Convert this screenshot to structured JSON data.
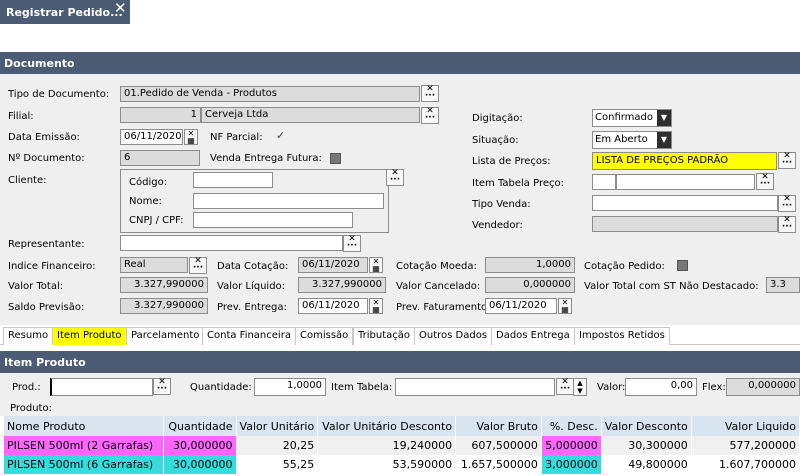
{
  "window": {
    "tab_title": "Registrar Pedido...",
    "close_glyph": "✕"
  },
  "colors": {
    "header": "#4b5b73",
    "highlight_yellow": "#ffff00",
    "magenta": "#ff66ff",
    "cyan": "#33dddd"
  },
  "documento": {
    "title": "Documento",
    "tipo_documento": {
      "label": "Tipo de Documento:",
      "value": "01.Pedido de Venda - Produtos"
    },
    "filial": {
      "label": "Filial:",
      "code": "1",
      "name": "Cerveja Ltda"
    },
    "data_emissao": {
      "label": "Data Emissão:",
      "value": "06/11/2020"
    },
    "nf_parcial": {
      "label": "NF Parcial:",
      "checked": "✓"
    },
    "n_documento": {
      "label": "Nº Documento:",
      "value": "6"
    },
    "venda_entrega_futura": {
      "label": "Venda Entrega Futura:"
    },
    "cliente": {
      "label": "Cliente:",
      "codigo_label": "Código:",
      "nome_label": "Nome:",
      "cnpj_label": "CNPJ / CPF:"
    },
    "digitacao": {
      "label": "Digitação:",
      "value": "Confirmado"
    },
    "situacao": {
      "label": "Situação:",
      "value": "Em Aberto"
    },
    "lista_precos": {
      "label": "Lista de Preços:",
      "value": "LISTA DE PREÇOS PADRÃO"
    },
    "item_tabela_preco": {
      "label": "Item Tabela Preço:"
    },
    "tipo_venda": {
      "label": "Tipo Venda:"
    },
    "vendedor": {
      "label": "Vendedor:"
    },
    "representante": {
      "label": "Representante:"
    },
    "indice_financeiro": {
      "label": "Indice Financeiro:",
      "value": "Real"
    },
    "data_cotacao": {
      "label": "Data Cotação:",
      "value": "06/11/2020"
    },
    "cotacao_moeda": {
      "label": "Cotação Moeda:",
      "value": "1,0000"
    },
    "cotacao_pedido": {
      "label": "Cotação Pedido:"
    },
    "valor_total": {
      "label": "Valor Total:",
      "value": "3.327,990000"
    },
    "valor_liquido": {
      "label": "Valor Líquido:",
      "value": "3.327,990000"
    },
    "valor_cancelado": {
      "label": "Valor Cancelado:",
      "value": "0,000000"
    },
    "valor_total_st": {
      "label": "Valor Total com ST Não Destacado:",
      "value": "3.3"
    },
    "saldo_previsao": {
      "label": "Saldo Previsão:",
      "value": "3.327,990000"
    },
    "prev_entrega": {
      "label": "Prev. Entrega:",
      "value": "06/11/2020"
    },
    "prev_faturamento": {
      "label": "Prev. Faturamento:",
      "value": "06/11/2020"
    }
  },
  "subtabs": [
    "Resumo",
    "Item Produto",
    "Parcelamento",
    "Conta Financeira",
    "Comissão",
    "Tributação",
    "Outros Dados",
    "Dados Entrega",
    "Impostos Retidos"
  ],
  "item_produto": {
    "title": "Item Produto",
    "prod_label": "Prod.:",
    "quantidade_label": "Quantidade:",
    "quantidade_value": "1,0000",
    "item_tabela_label": "Item Tabela:",
    "valor_label": "Valor:",
    "valor_value": "0,00",
    "flex_label": "Flex:",
    "flex_value": "0,000000",
    "produto_label": "Produto:"
  },
  "table": {
    "columns": [
      "Nome Produto",
      "Quantidade",
      "Valor Unitário",
      "Valor Unitário Desconto",
      "Valor Bruto",
      "%. Desc.",
      "Valor Desconto",
      "Valor Liquido"
    ],
    "rows": [
      [
        "PILSEN 500ml (2 Garrafas)",
        "30,000000",
        "20,25",
        "19,240000",
        "607,500000",
        "5,000000",
        "30,300000",
        "577,200000"
      ],
      [
        "PILSEN 500ml (6 Garrafas)",
        "30,000000",
        "55,25",
        "53,590000",
        "1.657,500000",
        "3,000000",
        "49,800000",
        "1.607,700000"
      ]
    ]
  }
}
